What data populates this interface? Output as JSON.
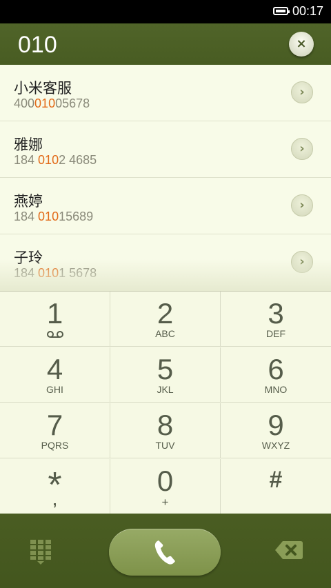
{
  "status_bar": {
    "time": "00:17"
  },
  "search": {
    "query": "010",
    "clear_label": "×"
  },
  "results": [
    {
      "name": "小米客服",
      "pre": "400",
      "match": "010",
      "post": "05678"
    },
    {
      "name": "雅娜",
      "pre": "184 ",
      "match": "010",
      "post": "2 4685"
    },
    {
      "name": "燕婷",
      "pre": "184 ",
      "match": "010",
      "post": "15689"
    },
    {
      "name": "子玲",
      "pre": "184 ",
      "match": "010",
      "post": "1 5678"
    }
  ],
  "keypad": [
    {
      "digit": "1",
      "letters": ""
    },
    {
      "digit": "2",
      "letters": "ABC"
    },
    {
      "digit": "3",
      "letters": "DEF"
    },
    {
      "digit": "4",
      "letters": "GHI"
    },
    {
      "digit": "5",
      "letters": "JKL"
    },
    {
      "digit": "6",
      "letters": "MNO"
    },
    {
      "digit": "7",
      "letters": "PQRS"
    },
    {
      "digit": "8",
      "letters": "TUV"
    },
    {
      "digit": "9",
      "letters": "WXYZ"
    },
    {
      "digit": "*",
      "letters": ","
    },
    {
      "digit": "0",
      "letters": "+"
    },
    {
      "digit": "#",
      "letters": ""
    }
  ],
  "icons": {
    "battery": "battery-icon",
    "clear": "close-icon",
    "row_arrow": "chevron-right-icon",
    "voicemail": "voicemail-icon",
    "dialpad": "dialpad-icon",
    "call": "phone-icon",
    "delete": "backspace-icon"
  },
  "colors": {
    "header_bg": "#4b5f25",
    "highlight": "#e26a18",
    "call_button": "#8a9d57",
    "list_bg": "#f8fbe8"
  }
}
